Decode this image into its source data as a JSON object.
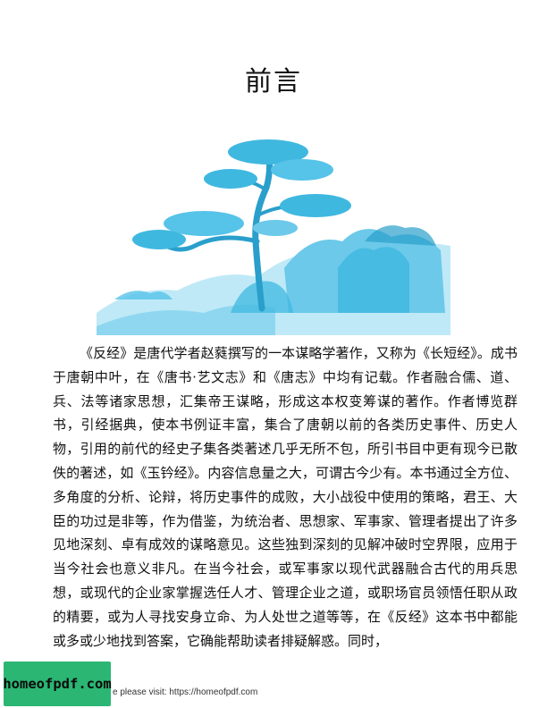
{
  "page": {
    "title": "前言",
    "illustration_icon": "pine-tree-landscape-icon",
    "body": "《反经》是唐代学者赵蕤撰写的一本谋略学著作，又称为《长短经》。成书于唐朝中叶，在《唐书·艺文志》和《唐志》中均有记载。作者融合儒、道、兵、法等诸家思想，汇集帝王谋略，形成这本权变筹谋的著作。作者博览群书，引经据典，使本书例证丰富，集合了唐朝以前的各类历史事件、历史人物，引用的前代的经史子集各类著述几乎无所不包，所引书目中更有现今已散佚的著述，如《玉钤经》。内容信息量之大，可谓古今少有。本书通过全方位、多角度的分析、论辩，将历史事件的成败，大小战役中使用的策略，君王、大臣的功过是非等，作为借鉴，为统治者、思想家、军事家、管理者提出了许多见地深刻、卓有成效的谋略意见。这些独到深刻的见解冲破时空界限，应用于当今社会也意义非凡。在当今社会，或军事家以现代武器融合古代的用兵思想，或现代的企业家掌握选任人才、管理企业之道，或职场官员领悟任职从政的精要，或为人寻找安身立命、为人处世之道等等，在《反经》这本书中都能或多或少地找到答案，它确能帮助读者排疑解惑。同时，",
    "colors": {
      "illustration": "#3fb8e0",
      "logo_bg": "#2bb673"
    }
  },
  "footer": {
    "logo_text": "homeofpdf.com",
    "visit_text": "e please visit: https://homeofpdf.com"
  }
}
